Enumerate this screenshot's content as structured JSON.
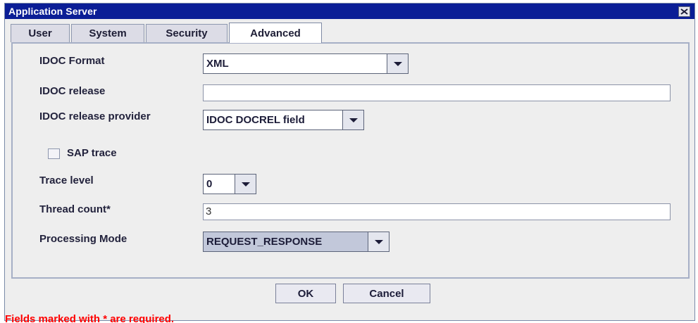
{
  "window": {
    "title": "Application Server"
  },
  "tabs": [
    {
      "label": "User",
      "active": false
    },
    {
      "label": "System",
      "active": false
    },
    {
      "label": "Security",
      "active": false
    },
    {
      "label": "Advanced",
      "active": true
    }
  ],
  "form": {
    "idoc_format": {
      "label": "IDOC Format",
      "value": "XML"
    },
    "idoc_release": {
      "label": "IDOC release",
      "value": ""
    },
    "idoc_release_provider": {
      "label": "IDOC release provider",
      "value": "IDOC DOCREL field"
    },
    "sap_trace": {
      "label": "SAP trace",
      "checked": false
    },
    "trace_level": {
      "label": "Trace level",
      "value": "0"
    },
    "thread_count": {
      "label": "Thread count*",
      "value": "3"
    },
    "processing_mode": {
      "label": "Processing Mode",
      "value": "REQUEST_RESPONSE"
    }
  },
  "buttons": {
    "ok": "OK",
    "cancel": "Cancel"
  },
  "footer": {
    "required_note": "Fields marked with * are required."
  },
  "colors": {
    "titlebar": "#0b1e96",
    "required_note": "#ff0000"
  },
  "icons": {
    "close": "close-icon",
    "dropdown": "chevron-down-icon"
  }
}
